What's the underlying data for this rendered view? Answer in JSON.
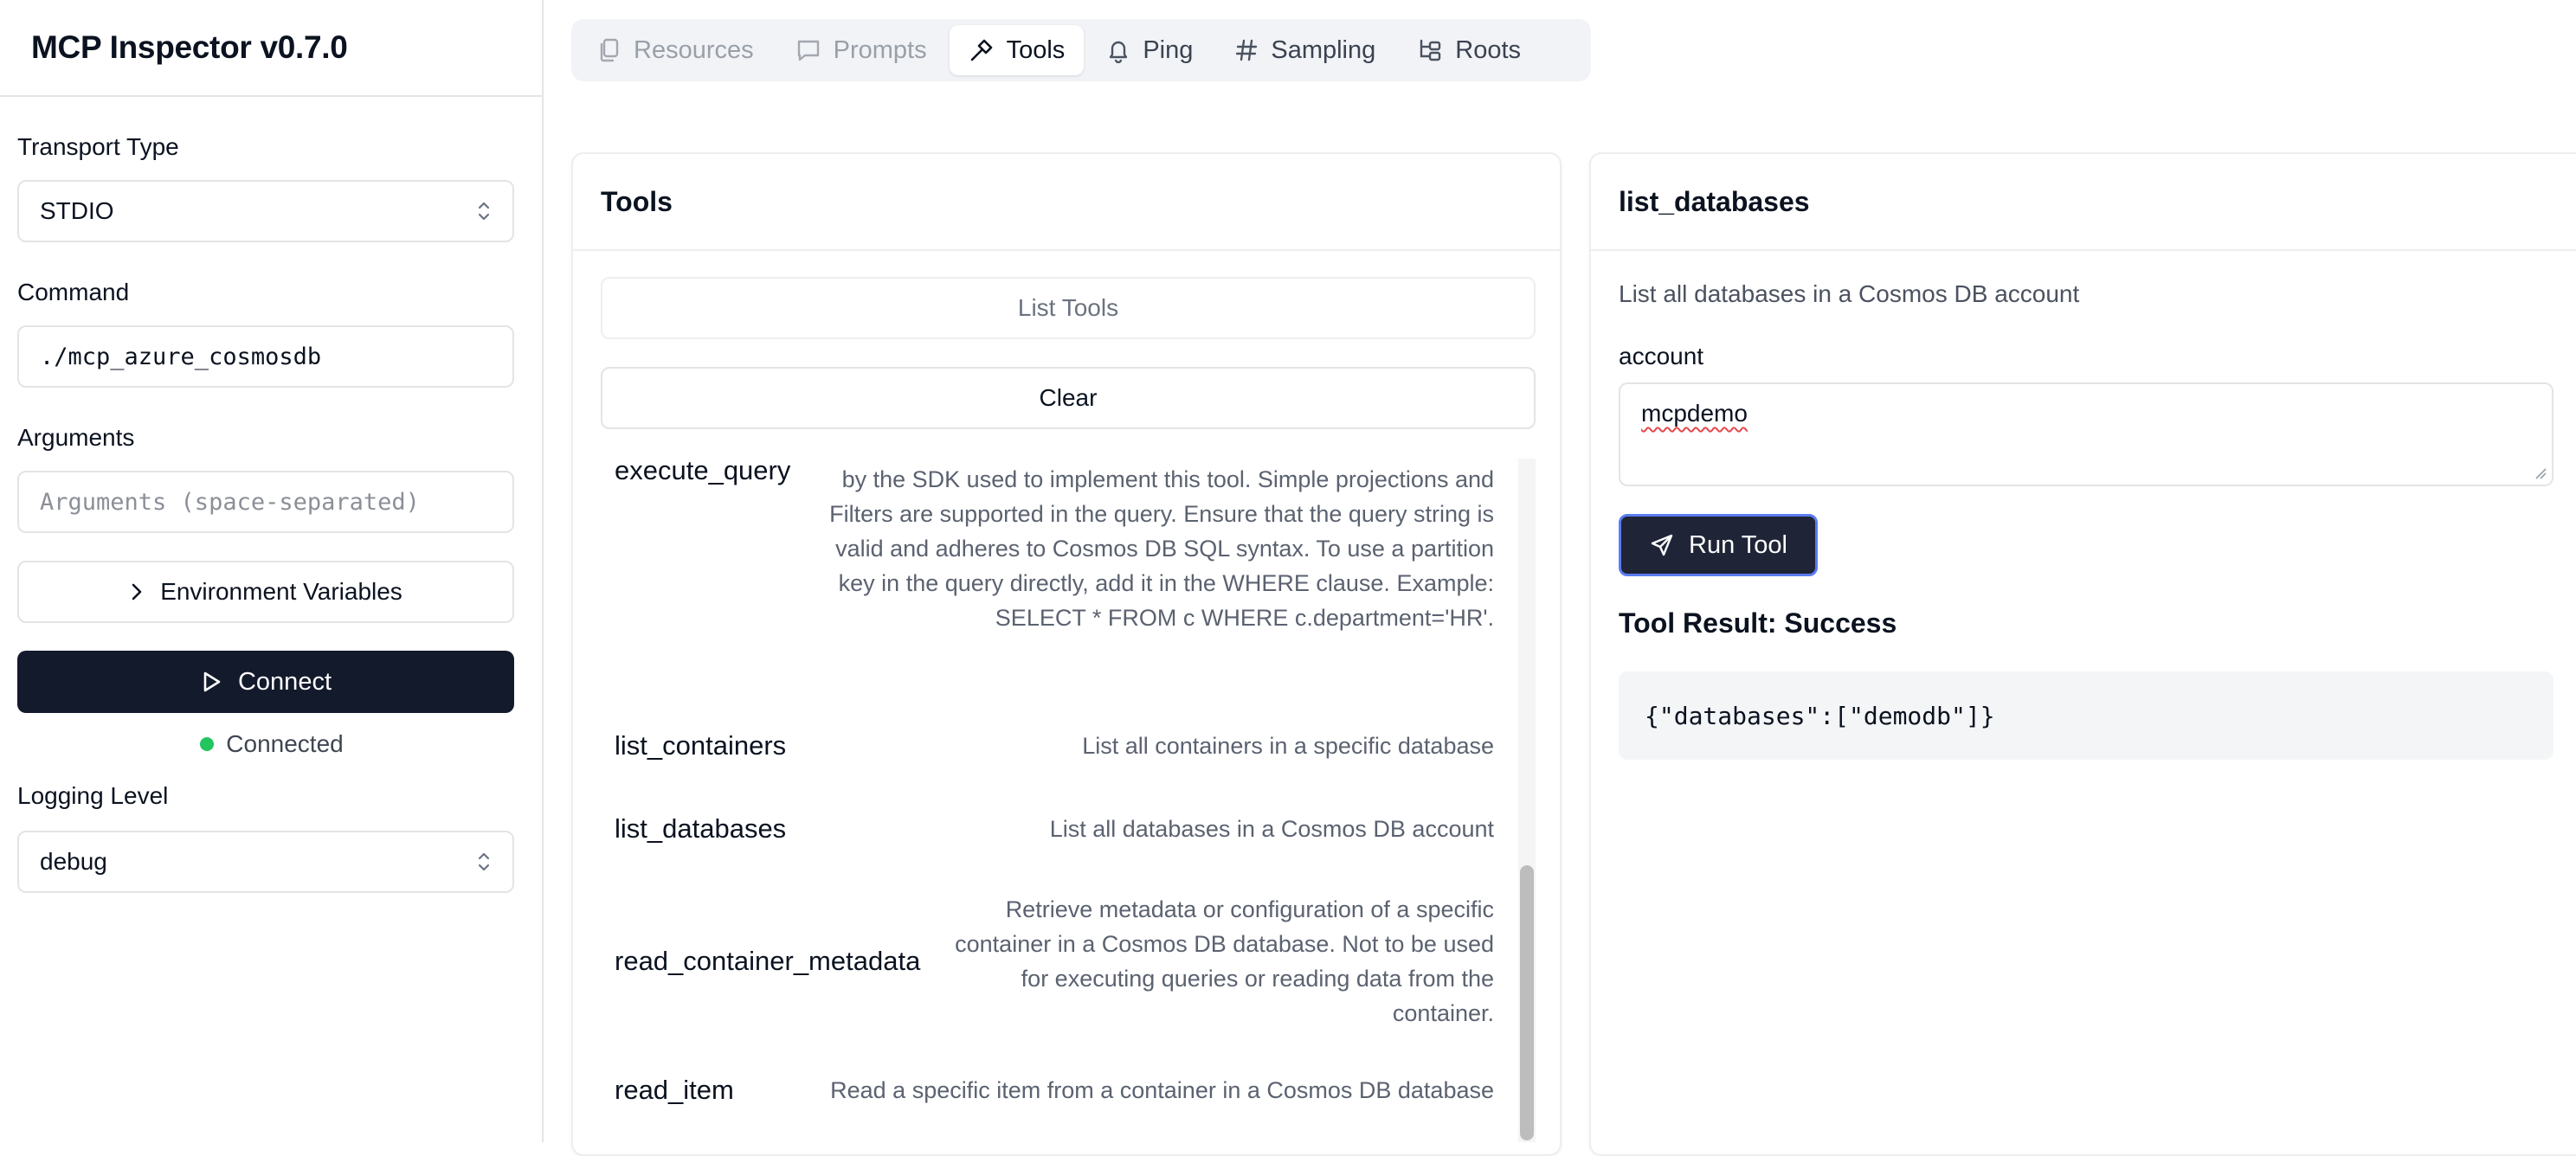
{
  "app": {
    "title": "MCP Inspector v0.7.0"
  },
  "sidebar": {
    "transport": {
      "label": "Transport Type",
      "value": "STDIO"
    },
    "command": {
      "label": "Command",
      "value": "./mcp_azure_cosmosdb"
    },
    "arguments": {
      "label": "Arguments",
      "placeholder": "Arguments (space-separated)"
    },
    "env_button": "Environment Variables",
    "connect_button": "Connect",
    "status": {
      "text": "Connected",
      "color": "#22c55e"
    },
    "logging": {
      "label": "Logging Level",
      "value": "debug"
    }
  },
  "tabs": [
    {
      "label": "Resources",
      "icon": "file-icon",
      "state": "disabled"
    },
    {
      "label": "Prompts",
      "icon": "message-icon",
      "state": "disabled"
    },
    {
      "label": "Tools",
      "icon": "hammer-icon",
      "state": "active"
    },
    {
      "label": "Ping",
      "icon": "bell-icon",
      "state": "normal"
    },
    {
      "label": "Sampling",
      "icon": "hash-icon",
      "state": "normal"
    },
    {
      "label": "Roots",
      "icon": "folder-tree-icon",
      "state": "normal"
    }
  ],
  "tools_panel": {
    "title": "Tools",
    "list_button": "List Tools",
    "clear_button": "Clear",
    "items": [
      {
        "name": "execute_query",
        "description": "and \"GROUP BY\" clauses in the query as they are not supported by the SDK used to implement this tool. Simple projections and Filters are supported in the query. Ensure that the query string is valid and adheres to Cosmos DB SQL syntax. To use a partition key in the query directly, add it in the WHERE clause. Example: SELECT * FROM c WHERE c.department='HR'."
      },
      {
        "name": "list_containers",
        "description": "List all containers in a specific database"
      },
      {
        "name": "list_databases",
        "description": "List all databases in a Cosmos DB account"
      },
      {
        "name": "read_container_metadata",
        "description": "Retrieve metadata or configuration of a specific container in a Cosmos DB database. Not to be used for executing queries or reading data from the container."
      },
      {
        "name": "read_item",
        "description": "Read a specific item from a container in a Cosmos DB database"
      }
    ]
  },
  "detail_panel": {
    "title": "list_databases",
    "description": "List all databases in a Cosmos DB account",
    "param_label": "account",
    "param_value": "mcpdemo",
    "run_button": "Run Tool",
    "result_title": "Tool Result: Success",
    "result_json": "{\"databases\":[\"demodb\"]}"
  },
  "colors": {
    "primary_dark": "#131a2c",
    "run_button_border": "#5b7cf0",
    "tab_bar_bg": "#f1f3f6"
  }
}
